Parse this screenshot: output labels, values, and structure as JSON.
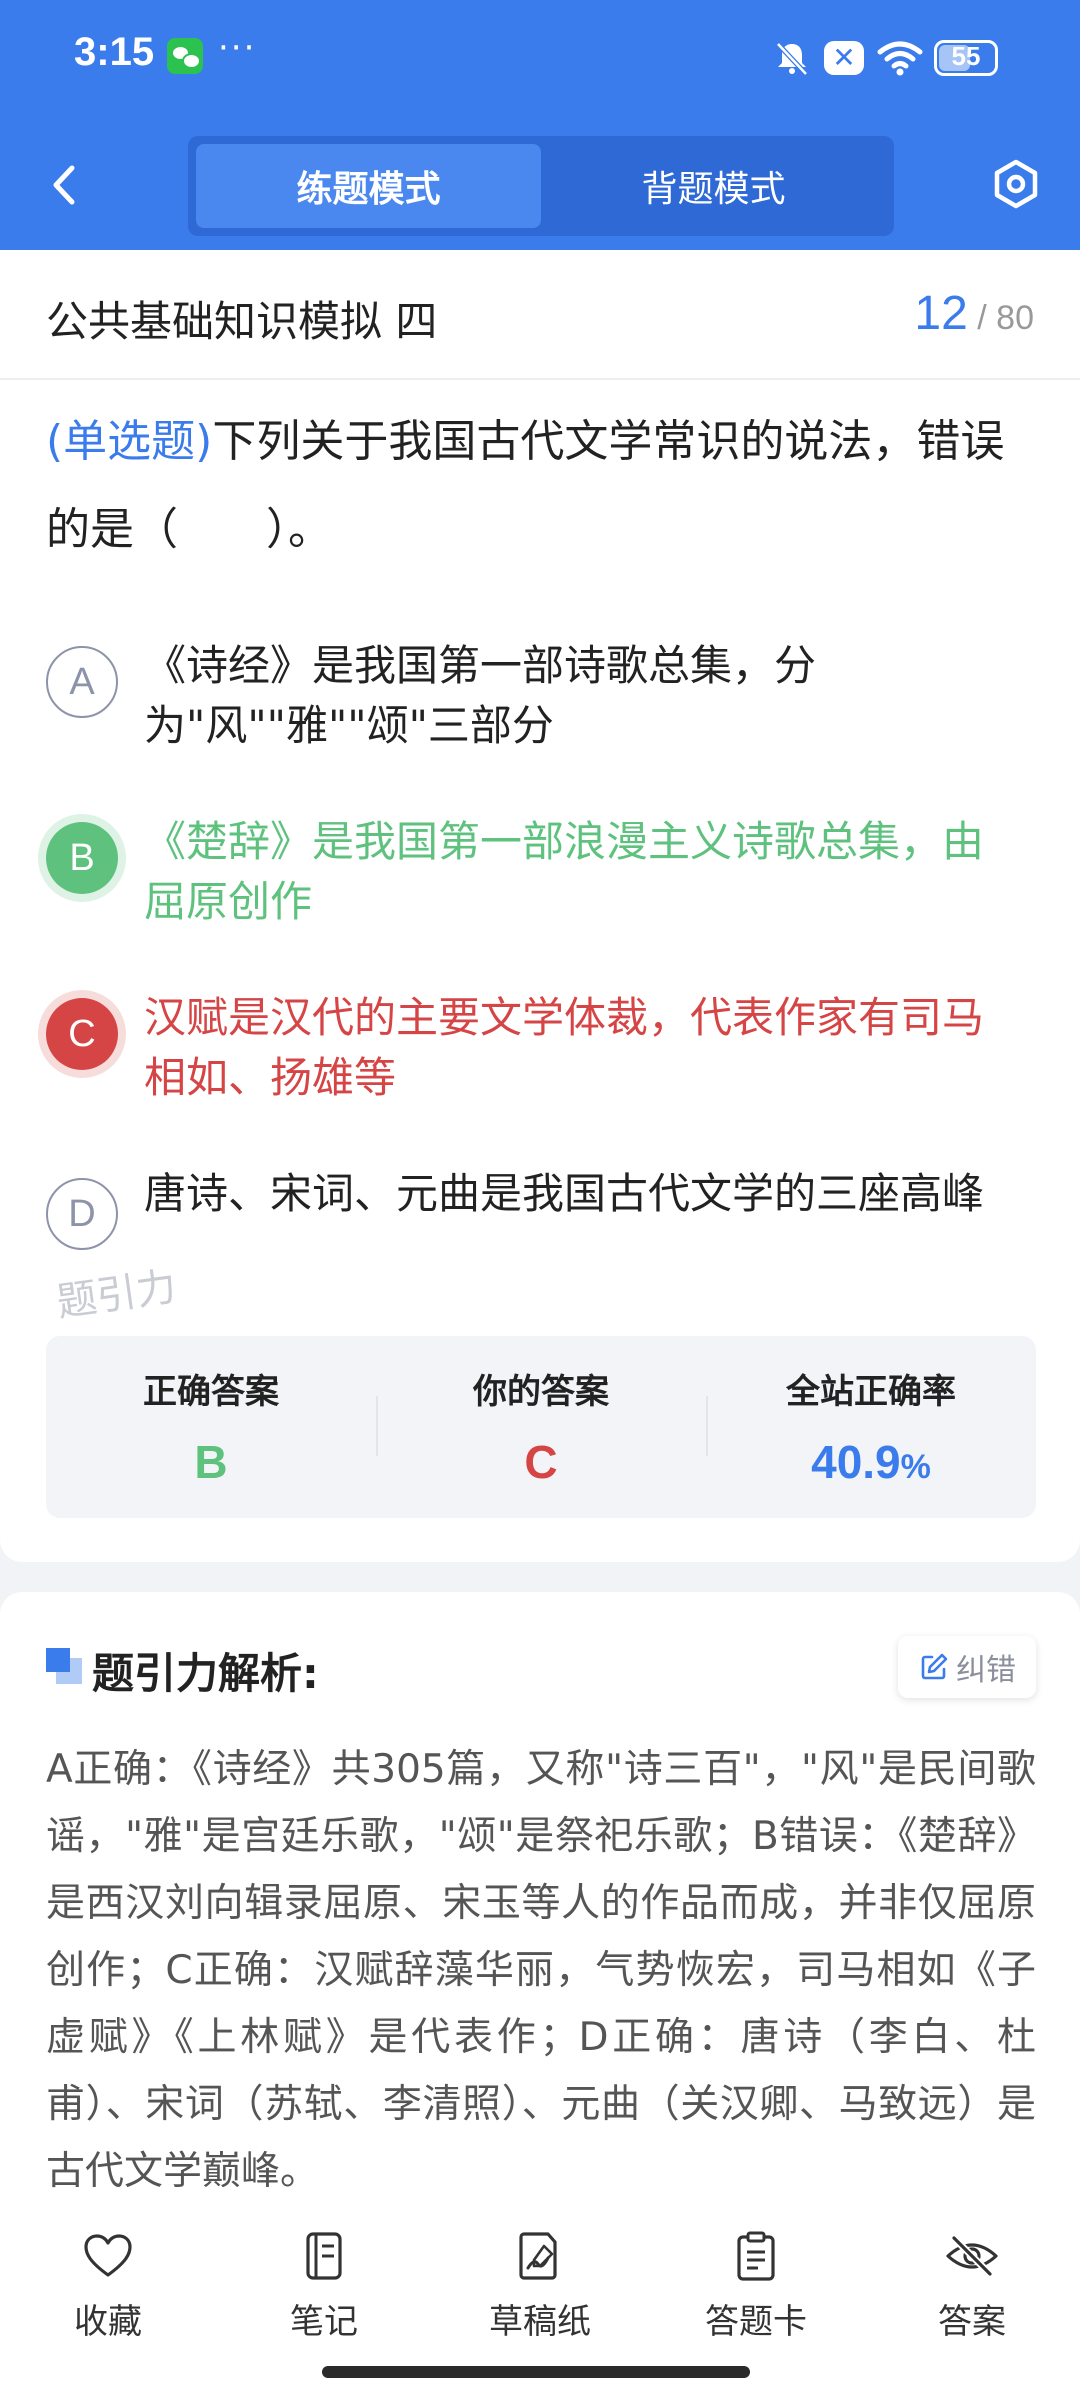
{
  "status_bar": {
    "time": "3:15",
    "more": "···",
    "battery": "55"
  },
  "header": {
    "tabs": [
      {
        "label": "练题模式",
        "active": true
      },
      {
        "label": "背题模式",
        "active": false
      }
    ]
  },
  "paper": {
    "title": "公共基础知识模拟 四",
    "current": "12",
    "separator": "/",
    "total": "80"
  },
  "question": {
    "type": "(单选题)",
    "text": "下列关于我国古代文学常识的说法，错误的是（　　）。"
  },
  "options": [
    {
      "letter": "A",
      "text": "《诗经》是我国第一部诗歌总集，分为\"风\"\"雅\"\"颂\"三部分",
      "state": "neutral"
    },
    {
      "letter": "B",
      "text": "《楚辞》是我国第一部浪漫主义诗歌总集，由屈原创作",
      "state": "correct"
    },
    {
      "letter": "C",
      "text": "汉赋是汉代的主要文学体裁，代表作家有司马相如、扬雄等",
      "state": "wrong"
    },
    {
      "letter": "D",
      "text": "唐诗、宋词、元曲是我国古代文学的三座高峰",
      "state": "neutral"
    }
  ],
  "watermark": "题引力",
  "answer_summary": {
    "correct_label": "正确答案",
    "correct_value": "B",
    "yours_label": "你的答案",
    "yours_value": "C",
    "rate_label": "全站正确率",
    "rate_value": "40.9",
    "rate_unit": "%"
  },
  "analysis": {
    "title": "题引力解析:",
    "report_label": "纠错",
    "text": "A正确：《诗经》共305篇，又称\"诗三百\"，\"风\"是民间歌谣，\"雅\"是宫廷乐歌，\"颂\"是祭祀乐歌；B错误：《楚辞》是西汉刘向辑录屈原、宋玉等人的作品而成，并非仅屈原创作；C正确：汉赋辞藻华丽，气势恢宏，司马相如《子虚赋》《上林赋》是代表作；D正确：唐诗（李白、杜甫）、宋词（苏轼、李清照）、元曲（关汉卿、马致远）是古代文学巅峰。"
  },
  "bottom_bar": [
    {
      "label": "收藏",
      "icon": "heart-icon"
    },
    {
      "label": "笔记",
      "icon": "notebook-icon"
    },
    {
      "label": "草稿纸",
      "icon": "draft-paper-icon"
    },
    {
      "label": "答题卡",
      "icon": "answer-sheet-icon"
    },
    {
      "label": "答案",
      "icon": "eye-off-icon"
    }
  ],
  "colors": {
    "brand_blue": "#3b7cec",
    "correct_green": "#5ec27e",
    "wrong_red": "#d64545"
  }
}
